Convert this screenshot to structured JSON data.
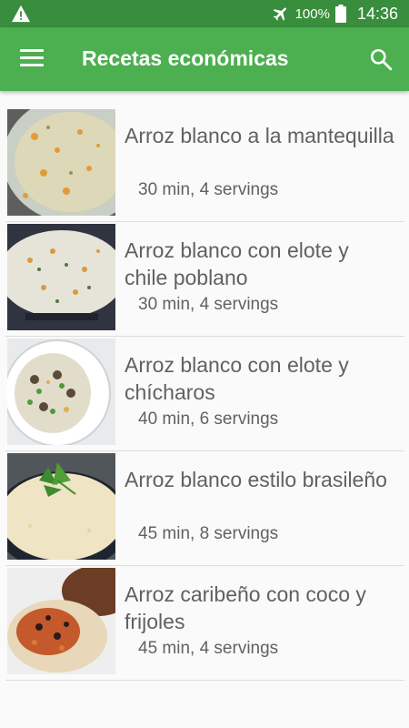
{
  "status": {
    "battery": "100%",
    "time": "14:36",
    "icons": [
      "warning-icon",
      "airplane-icon",
      "battery-icon"
    ]
  },
  "appbar": {
    "title": "Recetas económicas",
    "icons": [
      "menu-icon",
      "search-icon"
    ]
  },
  "recipes": [
    {
      "name": "Arroz blanco a la mantequilla",
      "meta": "30 min, 4 servings"
    },
    {
      "name": "Arroz blanco con elote y chile poblano",
      "meta": "30 min, 4 servings"
    },
    {
      "name": "Arroz blanco con elote y chícharos",
      "meta": "40 min, 6 servings"
    },
    {
      "name": "Arroz blanco estilo brasileño",
      "meta": "45 min, 8 servings"
    },
    {
      "name": "Arroz caribeño con coco y frijoles",
      "meta": "45 min, 4 servings"
    }
  ],
  "colors": {
    "statusbar": "#388e3c",
    "appbar": "#4caf50",
    "text": "#616161"
  }
}
